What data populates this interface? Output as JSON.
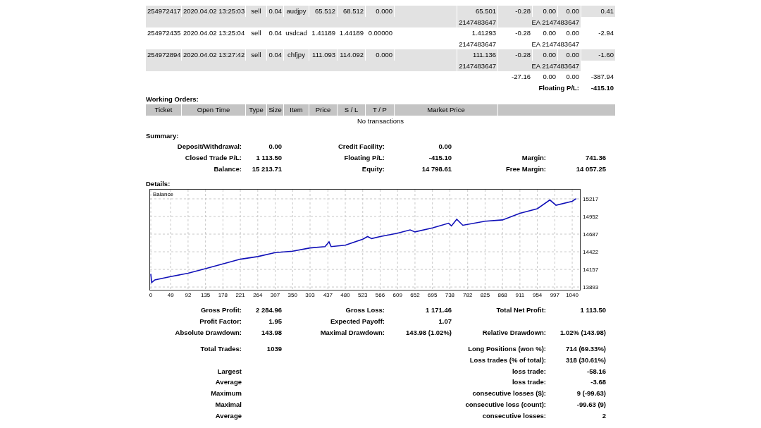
{
  "trades": {
    "rows": [
      {
        "cells": [
          "254972417",
          "2020.04.02 13:25:03",
          "sell",
          "0.04",
          "audjpy",
          "65.512",
          "68.512",
          "0.000",
          "65.501",
          "-0.28",
          "0.00",
          "0.00",
          "0.41"
        ],
        "sub": [
          "2147483647",
          "EA 2147483647"
        ]
      },
      {
        "cells": [
          "254972435",
          "2020.04.02 13:25:04",
          "sell",
          "0.04",
          "usdcad",
          "1.41189",
          "1.44189",
          "0.00000",
          "1.41293",
          "-0.28",
          "0.00",
          "0.00",
          "-2.94"
        ],
        "sub": [
          "2147483647",
          "EA 2147483647"
        ]
      },
      {
        "cells": [
          "254972894",
          "2020.04.02 13:27:42",
          "sell",
          "0.04",
          "chfjpy",
          "111.093",
          "114.092",
          "0.000",
          "111.136",
          "-0.28",
          "0.00",
          "0.00",
          "-1.60"
        ],
        "sub": [
          "2147483647",
          "EA 2147483647"
        ]
      }
    ],
    "totals": [
      "-27.16",
      "0.00",
      "0.00",
      "-387.94"
    ],
    "floating": {
      "label": "Floating P/L:",
      "value": "-415.10"
    }
  },
  "working_orders": {
    "title": "Working Orders:",
    "columns": [
      "Ticket",
      "Open Time",
      "Type",
      "Size",
      "Item",
      "Price",
      "S / L",
      "T / P",
      "Market Price"
    ],
    "empty_text": "No transactions"
  },
  "summary": {
    "title": "Summary:",
    "rows": [
      {
        "left": {
          "label": "Deposit/Withdrawal:",
          "value": "0.00"
        },
        "middle": {
          "label": "Credit Facility:",
          "value": "0.00"
        }
      },
      {
        "left": {
          "label": "Closed Trade P/L:",
          "value": "1 113.50"
        },
        "middle": {
          "label": "Floating P/L:",
          "value": "-415.10"
        },
        "right": {
          "label": "Margin:",
          "value": "741.36"
        }
      },
      {
        "left": {
          "label": "Balance:",
          "value": "15 213.71"
        },
        "middle": {
          "label": "Equity:",
          "value": "14 798.61"
        },
        "right": {
          "label": "Free Margin:",
          "value": "14 057.25"
        }
      }
    ]
  },
  "details": {
    "title": "Details:",
    "chart_data": {
      "type": "line",
      "grid": true,
      "xlim": [
        0,
        1059
      ],
      "ylim": [
        13851,
        15365
      ],
      "xticks": [
        0,
        49,
        92,
        135,
        178,
        221,
        264,
        307,
        350,
        393,
        437,
        480,
        523,
        566,
        609,
        652,
        695,
        738,
        782,
        825,
        868,
        911,
        954,
        997,
        1040
      ],
      "yticks": [
        13893,
        14157,
        14422,
        14687,
        14952,
        15217
      ],
      "x": [
        0,
        2,
        10,
        49,
        92,
        135,
        178,
        221,
        264,
        307,
        350,
        393,
        430,
        440,
        445,
        480,
        523,
        535,
        545,
        566,
        609,
        640,
        652,
        695,
        735,
        742,
        755,
        770,
        825,
        868,
        911,
        954,
        985,
        1000,
        1040,
        1050
      ],
      "series": [
        {
          "name": "Balance",
          "color": "#1010b8",
          "values": [
            14090,
            13960,
            14000,
            14050,
            14100,
            14170,
            14240,
            14310,
            14350,
            14410,
            14430,
            14480,
            14500,
            14570,
            14500,
            14520,
            14610,
            14650,
            14620,
            14650,
            14700,
            14750,
            14720,
            14780,
            14850,
            14810,
            14910,
            14820,
            14880,
            14900,
            15000,
            15070,
            15200,
            15120,
            15180,
            15220
          ]
        }
      ]
    }
  },
  "stats": {
    "rows": [
      {
        "left": {
          "label": "Gross Profit:",
          "value": "2 284.96"
        },
        "middle": {
          "label": "Gross Loss:",
          "value": "1 171.46"
        },
        "right": {
          "label": "Total Net Profit:",
          "value": "1 113.50"
        }
      },
      {
        "left": {
          "label": "Profit Factor:",
          "value": "1.95"
        },
        "middle": {
          "label": "Expected Payoff:",
          "value": "1.07"
        }
      },
      {
        "left": {
          "label": "Absolute Drawdown:",
          "value": "143.98"
        },
        "middle": {
          "label": "Maximal Drawdown:",
          "value": "143.98 (1.02%)"
        },
        "right": {
          "label": "Relative Drawdown:",
          "value": "1.02% (143.98)"
        }
      },
      {
        "gap": true,
        "left": {
          "label": "Total Trades:",
          "value": "1039"
        },
        "right": {
          "label": "Long Positions (won %):",
          "value": "714 (69.33%)"
        }
      },
      {
        "right": {
          "label": "Loss trades (% of total):",
          "value": "318 (30.61%)"
        }
      },
      {
        "left": {
          "label": "Largest"
        },
        "right": {
          "label": "loss trade:",
          "value": "-58.16"
        }
      },
      {
        "left": {
          "label": "Average"
        },
        "right": {
          "label": "loss trade:",
          "value": "-3.68"
        }
      },
      {
        "left": {
          "label": "Maximum"
        },
        "right": {
          "label": "consecutive losses ($):",
          "value": "9 (-99.63)"
        }
      },
      {
        "left": {
          "label": "Maximal"
        },
        "right": {
          "label": "consecutive loss (count):",
          "value": "-99.63 (9)"
        }
      },
      {
        "left": {
          "label": "Average"
        },
        "right": {
          "label": "consecutive losses:",
          "value": "2"
        }
      }
    ]
  }
}
